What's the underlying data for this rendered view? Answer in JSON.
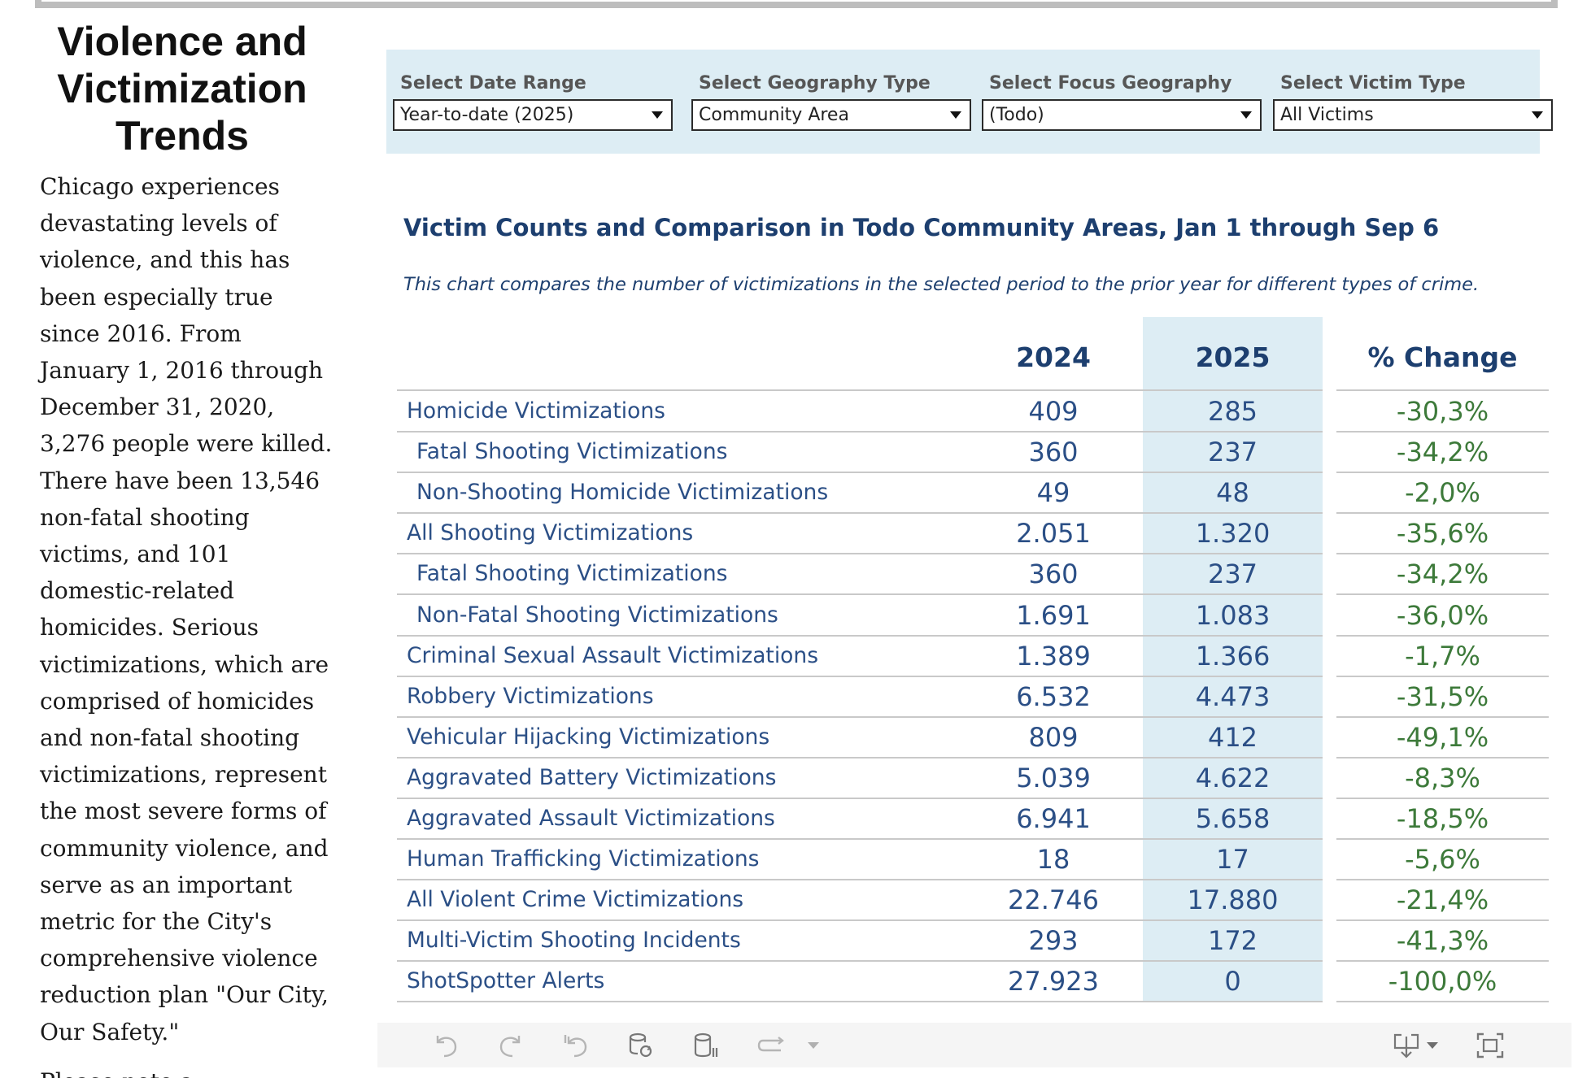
{
  "page": {
    "title_lines": [
      "Violence and",
      "Victimization",
      "Trends"
    ],
    "narrative": "Chicago experiences devastating levels of violence, and this has been especially true since 2016. From January 1, 2016 through December 31, 2020, 3,276 people were killed. There have been 13,546 non-fatal shooting victims, and 101 domestic-related homicides. Serious victimizations, which are comprised of homicides and non-fatal shooting victimizations, represent the most severe forms of community violence, and serve as an important metric for the City's comprehensive violence reduction plan \"Our City, Our Safety.\"",
    "narrative_cutoff": "Please note a"
  },
  "filters": [
    {
      "label": "Select Date Range",
      "value": "Year-to-date (2025)"
    },
    {
      "label": "Select Geography Type",
      "value": "Community Area"
    },
    {
      "label": "Select Focus Geography",
      "value": "(Todo)"
    },
    {
      "label": "Select Victim Type",
      "value": "All Victims"
    }
  ],
  "table": {
    "title": "Victim Counts and Comparison  in Todo Community Areas, Jan 1 through Sep 6",
    "subtitle": "This chart compares the number of victimizations in the selected period to the prior year for different types of crime.",
    "columns": [
      "2024",
      "2025",
      "% Change"
    ],
    "rows": [
      {
        "label": "Homicide Victimizations",
        "indent": false,
        "v2024": "409",
        "v2025": "285",
        "change": "-30,3%"
      },
      {
        "label": "Fatal Shooting Victimizations",
        "indent": true,
        "v2024": "360",
        "v2025": "237",
        "change": "-34,2%"
      },
      {
        "label": "Non-Shooting Homicide Victimizations",
        "indent": true,
        "v2024": "49",
        "v2025": "48",
        "change": "-2,0%"
      },
      {
        "label": "All Shooting Victimizations",
        "indent": false,
        "v2024": "2.051",
        "v2025": "1.320",
        "change": "-35,6%"
      },
      {
        "label": "Fatal Shooting Victimizations",
        "indent": true,
        "v2024": "360",
        "v2025": "237",
        "change": "-34,2%"
      },
      {
        "label": "Non-Fatal Shooting Victimizations",
        "indent": true,
        "v2024": "1.691",
        "v2025": "1.083",
        "change": "-36,0%"
      },
      {
        "label": "Criminal Sexual Assault Victimizations",
        "indent": false,
        "v2024": "1.389",
        "v2025": "1.366",
        "change": "-1,7%"
      },
      {
        "label": "Robbery Victimizations",
        "indent": false,
        "v2024": "6.532",
        "v2025": "4.473",
        "change": "-31,5%"
      },
      {
        "label": "Vehicular Hijacking Victimizations",
        "indent": false,
        "v2024": "809",
        "v2025": "412",
        "change": "-49,1%"
      },
      {
        "label": "Aggravated Battery Victimizations",
        "indent": false,
        "v2024": "5.039",
        "v2025": "4.622",
        "change": "-8,3%"
      },
      {
        "label": "Aggravated Assault Victimizations",
        "indent": false,
        "v2024": "6.941",
        "v2025": "5.658",
        "change": "-18,5%"
      },
      {
        "label": "Human Trafficking Victimizations",
        "indent": false,
        "v2024": "18",
        "v2025": "17",
        "change": "-5,6%"
      },
      {
        "label": "All Violent Crime Victimizations",
        "indent": false,
        "v2024": "22.746",
        "v2025": "17.880",
        "change": "-21,4%"
      },
      {
        "label": "Multi-Victim Shooting Incidents",
        "indent": false,
        "v2024": "293",
        "v2025": "172",
        "change": "-41,3%"
      },
      {
        "label": "ShotSpotter Alerts",
        "indent": false,
        "v2024": "27.923",
        "v2025": "0",
        "change": "-100,0%"
      }
    ]
  },
  "toolbar": {
    "buttons": [
      "undo-icon",
      "redo-icon",
      "revert-icon",
      "refresh-data-icon",
      "pause-updates-icon",
      "share-icon",
      "download-icon",
      "fullscreen-icon"
    ]
  },
  "colors": {
    "accent_text": "#1d3f6f",
    "row_text": "#2b4f86",
    "change_text": "#3d7a3a",
    "highlight_bg": "#ddedf4"
  }
}
